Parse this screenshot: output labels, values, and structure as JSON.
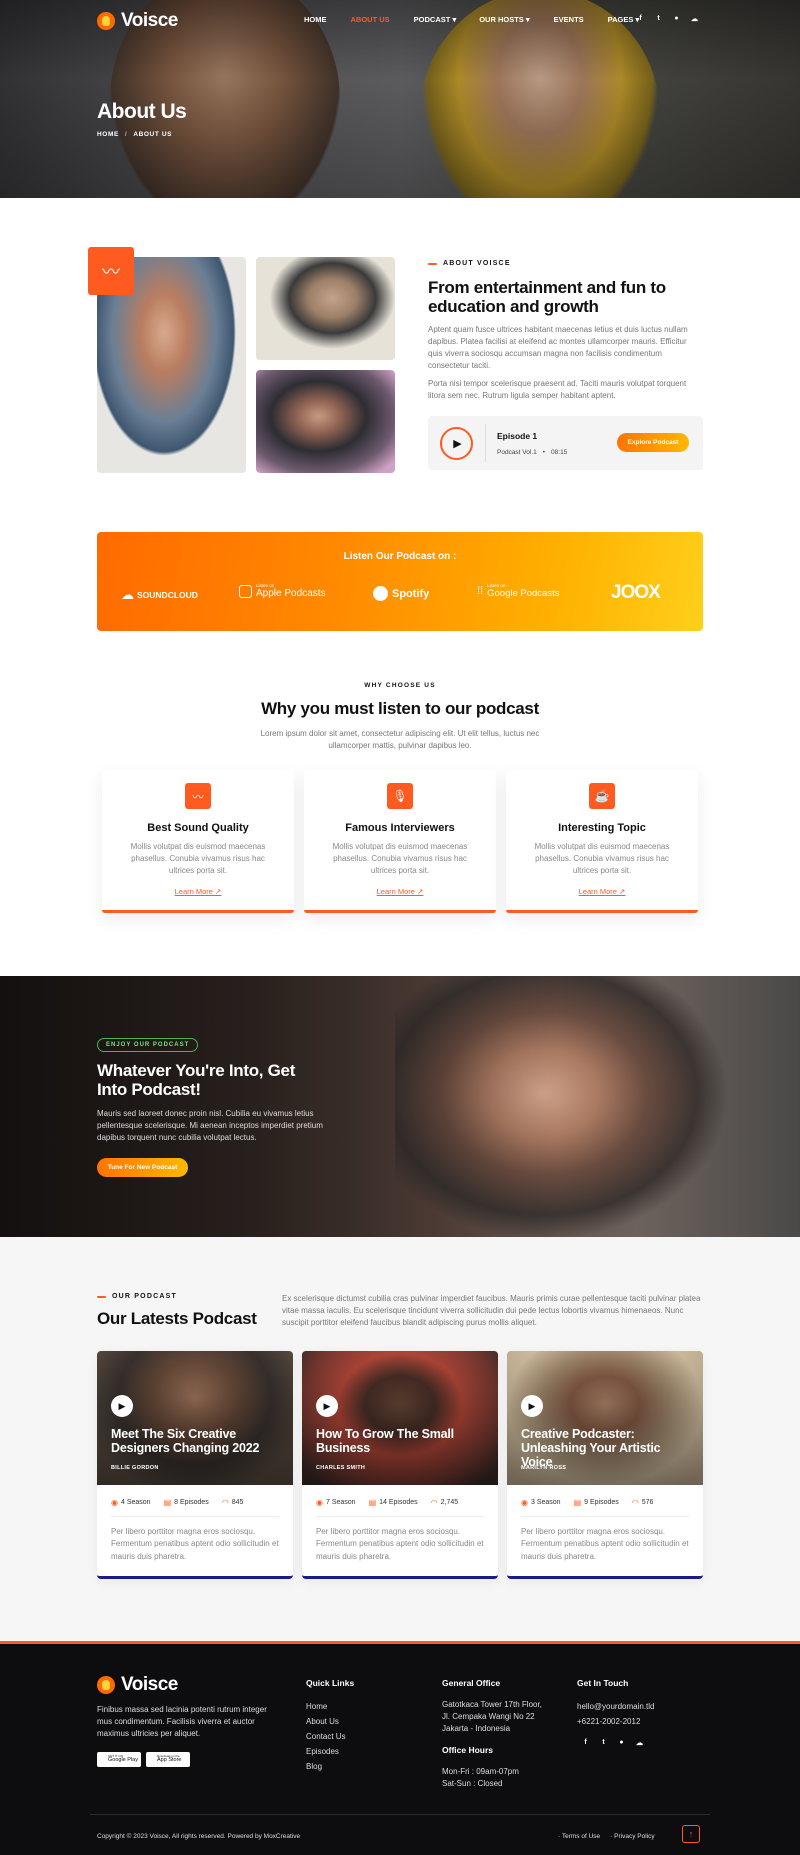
{
  "brand": {
    "name": "Voisce",
    "accent": "#ff5a1f"
  },
  "nav": {
    "items": [
      "HOME",
      "ABOUT US",
      "PODCAST",
      "OUR HOSTS",
      "EVENTS",
      "PAGES"
    ],
    "active": "ABOUT US"
  },
  "socials": [
    "facebook-icon",
    "twitter-icon",
    "pinterest-icon",
    "soundcloud-icon"
  ],
  "hero": {
    "title": "About Us",
    "breadcrumb": {
      "home": "HOME",
      "sep": "/",
      "current": "ABOUT US"
    }
  },
  "about": {
    "label": "ABOUT VOISCE",
    "title": "From entertainment and fun to education and growth",
    "para1": "Aptent quam fusce ultrices habitant maecenas letius et duis luctus nullam dapibus. Platea facilisi at eleifend ac montes ullamcorper mauris. Efficitur quis viverra sociosqu accumsan magna non facilisis condimentum consectetur taciti.",
    "para2": "Porta nisi tempor scelerisque praesent ad. Taciti mauris volutpat torquent litora sem nec. Rutrum ligula semper habitant aptent.",
    "player": {
      "episode": "Episode 1",
      "volume": "Podcast Vol.1",
      "dot": "•",
      "duration": "08:15",
      "button": "Explore Podcast"
    }
  },
  "platforms": {
    "title": "Listen Our Podcast on :",
    "items": [
      {
        "name": "SOUNDCLOUD",
        "small": ""
      },
      {
        "name": "Apple Podcasts",
        "small": "Listen on"
      },
      {
        "name": "Spotify",
        "small": ""
      },
      {
        "name": "Google Podcasts",
        "small": "Listen on"
      },
      {
        "name": "JOOX",
        "small": ""
      }
    ]
  },
  "why": {
    "label": "WHY CHOOSE US",
    "title": "Why you must listen to our podcast",
    "desc": "Lorem ipsum dolor sit amet, consectetur adipiscing elit. Ut elit tellus, luctus nec ullamcorper mattis, pulvinar dapibus leo.",
    "cards": [
      {
        "title": "Best Sound Quality",
        "text": "Mollis volutpat dis euismod maecenas phasellus. Conubia vivamus risus hac ultrices porta sit.",
        "link": "Learn More ↗"
      },
      {
        "title": "Famous Interviewers",
        "text": "Mollis volutpat dis euismod maecenas phasellus. Conubia vivamus risus hac ultrices porta sit.",
        "link": "Learn More ↗"
      },
      {
        "title": "Interesting Topic",
        "text": "Mollis volutpat dis euismod maecenas phasellus. Conubia vivamus risus hac ultrices porta sit.",
        "link": "Learn More ↗"
      }
    ]
  },
  "banner": {
    "badge": "ENJOY OUR PODCAST",
    "title": "Whatever You're Into, Get Into Podcast!",
    "text": "Mauris sed laoreet donec proin nisl. Cubilia eu vivamus letius pellentesque scelerisque. Mi aenean inceptos imperdiet pretium dapibus torquent nunc cubilia volutpat lectus.",
    "button": "Tune For New Podcast"
  },
  "latest": {
    "label": "OUR PODCAST",
    "title": "Our Latests Podcast",
    "desc": "Ex scelerisque dictumst cubilia cras pulvinar imperdiet faucibus. Mauris primis curae pellentesque taciti pulvinar platea vitae massa iaculis. Eu scelerisque tincidunt viverra sollicitudin dui pede lectus lobortis vivamus himenaeos. Nunc suscipit porttitor eleifend faucibus blandit adipiscing purus mollis aliquet.",
    "cards": [
      {
        "title": "Meet The Six Creative Designers Changing 2022",
        "author": "BILLIE GORDON",
        "seasons": "4 Season",
        "episodes": "8 Episodes",
        "listens": "845",
        "text": "Per libero porttitor magna eros sociosqu. Fermentum penatibus aptent odio sollicitudin et mauris duis pharetra."
      },
      {
        "title": "How To Grow The Small Business",
        "author": "CHARLES SMITH",
        "seasons": "7 Season",
        "episodes": "14 Episodes",
        "listens": "2,745",
        "text": "Per libero porttitor magna eros sociosqu. Fermentum penatibus aptent odio sollicitudin et mauris duis pharetra."
      },
      {
        "title": "Creative Podcaster: Unleashing Your Artistic Voice",
        "author": "MARILYN ROSS",
        "seasons": "3 Season",
        "episodes": "9 Episodes",
        "listens": "576",
        "text": "Per libero porttitor magna eros sociosqu. Fermentum penatibus aptent odio sollicitudin et mauris duis pharetra."
      }
    ]
  },
  "footer": {
    "about": "Finibus massa sed lacinia potenti rutrum integer mus condimentum. Facilisis viverra et auctor maximus ultricies per aliquet.",
    "stores": [
      {
        "small": "GET IT ON",
        "name": "Google Play"
      },
      {
        "small": "Download on the",
        "name": "App Store"
      }
    ],
    "quick_title": "Quick Links",
    "quick_links": [
      "Home",
      "About Us",
      "Contact Us",
      "Episodes",
      "Blog"
    ],
    "office_title": "General Office",
    "office_address": [
      "Gatotkaca Tower 17th Floor,",
      "Jl. Cempaka Wangi No 22",
      "Jakarta - Indonesia"
    ],
    "hours_title": "Office Hours",
    "hours": [
      "Mon-Fri : 09am-07pm",
      "Sat-Sun : Closed"
    ],
    "touch_title": "Get In Touch",
    "email": "hello@yourdomain.tld",
    "phone": "+6221-2002-2012",
    "copyright": "Copyright © 2023 Voisce, All rights reserved. Powered by MoxCreative",
    "terms": "Terms of Use",
    "privacy": "Privacy Policy"
  }
}
